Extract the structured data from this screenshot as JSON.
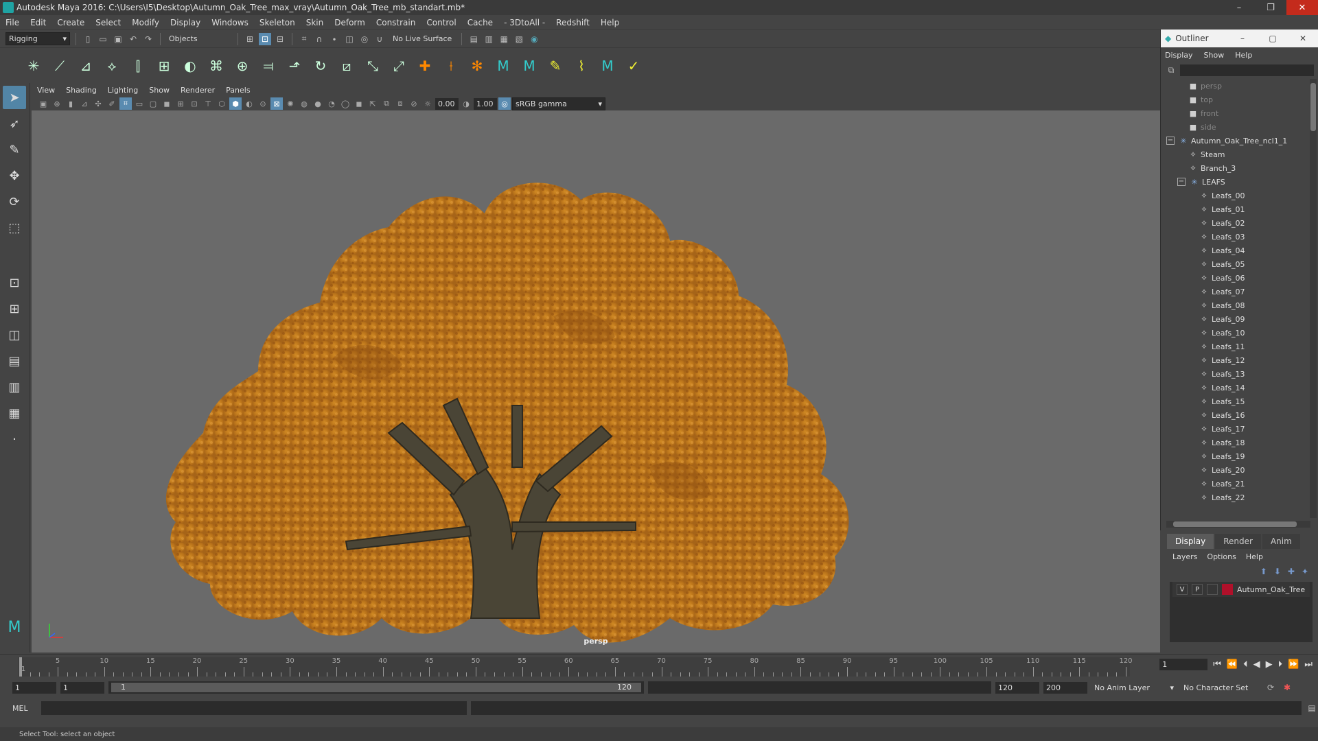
{
  "window": {
    "title": "Autodesk Maya 2016: C:\\Users\\I5\\Desktop\\Autumn_Oak_Tree_max_vray\\Autumn_Oak_Tree_mb_standart.mb*",
    "minimize": "–",
    "maximize": "❐",
    "close": "✕"
  },
  "menubar": [
    "File",
    "Edit",
    "Create",
    "Select",
    "Modify",
    "Display",
    "Windows",
    "Skeleton",
    "Skin",
    "Deform",
    "Constrain",
    "Control",
    "Cache",
    "- 3DtoAll -",
    "Redshift",
    "Help"
  ],
  "statusline": {
    "mode": "Rigging",
    "selection": "Objects",
    "live_surface": "No Live Surface"
  },
  "panel_menu": [
    "View",
    "Shading",
    "Lighting",
    "Show",
    "Renderer",
    "Panels"
  ],
  "panel_toolbar": {
    "exposure": "0.00",
    "gamma": "1.00",
    "color_space": "sRGB gamma"
  },
  "viewport": {
    "camera": "persp"
  },
  "outliner": {
    "title": "Outliner",
    "menu": [
      "Display",
      "Show",
      "Help"
    ],
    "items": [
      {
        "label": "persp",
        "indent": 2,
        "icon": "camera-icon",
        "dim": true
      },
      {
        "label": "top",
        "indent": 2,
        "icon": "camera-icon",
        "dim": true
      },
      {
        "label": "front",
        "indent": 2,
        "icon": "camera-icon",
        "dim": true
      },
      {
        "label": "side",
        "indent": 2,
        "icon": "camera-icon",
        "dim": true
      },
      {
        "label": "Autumn_Oak_Tree_ncl1_1",
        "indent": 0,
        "icon": "group-icon",
        "expander": "−"
      },
      {
        "label": "Steam",
        "indent": 2,
        "icon": "mesh-icon"
      },
      {
        "label": "Branch_3",
        "indent": 2,
        "icon": "mesh-icon"
      },
      {
        "label": "LEAFS",
        "indent": 1,
        "icon": "group-icon",
        "expander": "−"
      },
      {
        "label": "Leafs_00",
        "indent": 3,
        "icon": "mesh-icon"
      },
      {
        "label": "Leafs_01",
        "indent": 3,
        "icon": "mesh-icon"
      },
      {
        "label": "Leafs_02",
        "indent": 3,
        "icon": "mesh-icon"
      },
      {
        "label": "Leafs_03",
        "indent": 3,
        "icon": "mesh-icon"
      },
      {
        "label": "Leafs_04",
        "indent": 3,
        "icon": "mesh-icon"
      },
      {
        "label": "Leafs_05",
        "indent": 3,
        "icon": "mesh-icon"
      },
      {
        "label": "Leafs_06",
        "indent": 3,
        "icon": "mesh-icon"
      },
      {
        "label": "Leafs_07",
        "indent": 3,
        "icon": "mesh-icon"
      },
      {
        "label": "Leafs_08",
        "indent": 3,
        "icon": "mesh-icon"
      },
      {
        "label": "Leafs_09",
        "indent": 3,
        "icon": "mesh-icon"
      },
      {
        "label": "Leafs_10",
        "indent": 3,
        "icon": "mesh-icon"
      },
      {
        "label": "Leafs_11",
        "indent": 3,
        "icon": "mesh-icon"
      },
      {
        "label": "Leafs_12",
        "indent": 3,
        "icon": "mesh-icon"
      },
      {
        "label": "Leafs_13",
        "indent": 3,
        "icon": "mesh-icon"
      },
      {
        "label": "Leafs_14",
        "indent": 3,
        "icon": "mesh-icon"
      },
      {
        "label": "Leafs_15",
        "indent": 3,
        "icon": "mesh-icon"
      },
      {
        "label": "Leafs_16",
        "indent": 3,
        "icon": "mesh-icon"
      },
      {
        "label": "Leafs_17",
        "indent": 3,
        "icon": "mesh-icon"
      },
      {
        "label": "Leafs_18",
        "indent": 3,
        "icon": "mesh-icon"
      },
      {
        "label": "Leafs_19",
        "indent": 3,
        "icon": "mesh-icon"
      },
      {
        "label": "Leafs_20",
        "indent": 3,
        "icon": "mesh-icon"
      },
      {
        "label": "Leafs_21",
        "indent": 3,
        "icon": "mesh-icon"
      },
      {
        "label": "Leafs_22",
        "indent": 3,
        "icon": "mesh-icon"
      }
    ]
  },
  "layer_editor": {
    "tabs": [
      "Display",
      "Render",
      "Anim"
    ],
    "menu": [
      "Layers",
      "Options",
      "Help"
    ],
    "layer": {
      "visible": "V",
      "playback": "P",
      "name": "Autumn_Oak_Tree",
      "color": "#b0102a"
    }
  },
  "timeline": {
    "ticks": [
      5,
      10,
      15,
      20,
      25,
      30,
      35,
      40,
      45,
      50,
      55,
      60,
      65,
      70,
      75,
      80,
      85,
      90,
      95,
      100,
      105,
      110,
      115,
      120
    ],
    "start_label": "1",
    "current_frame": "1"
  },
  "range": {
    "start": "1",
    "playback_start": "1",
    "slider_start": "1",
    "slider_end": "120",
    "playback_end": "120",
    "end": "200",
    "anim_layer": "No Anim Layer",
    "character_set": "No Character Set"
  },
  "command": {
    "lang": "MEL"
  },
  "help_line": "Select Tool: select an object",
  "colors": {
    "accent": "#5285a6",
    "leaf": "#c27a1a",
    "viewport_bg": "#6a6a6a"
  }
}
